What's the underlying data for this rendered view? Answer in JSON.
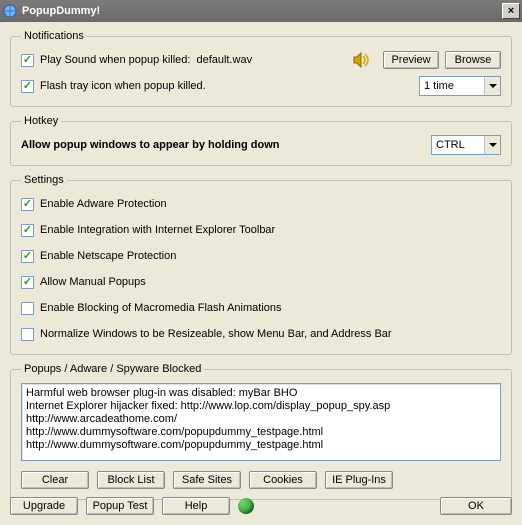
{
  "window": {
    "title": "PopupDummy!",
    "close_glyph": "×"
  },
  "notifications": {
    "legend": "Notifications",
    "play_sound_checked": true,
    "play_sound_label": "Play Sound when popup killed:",
    "sound_file": "default.wav",
    "preview_label": "Preview",
    "browse_label": "Browse",
    "flash_tray_checked": true,
    "flash_tray_label": "Flash tray icon when popup killed.",
    "flash_times_value": "1 time"
  },
  "hotkey": {
    "legend": "Hotkey",
    "label": "Allow popup windows to appear by holding down",
    "value": "CTRL"
  },
  "settings": {
    "legend": "Settings",
    "items": [
      {
        "checked": true,
        "label": "Enable Adware Protection"
      },
      {
        "checked": true,
        "label": "Enable Integration with Internet Explorer Toolbar"
      },
      {
        "checked": true,
        "label": "Enable Netscape Protection"
      },
      {
        "checked": true,
        "label": "Allow Manual Popups"
      },
      {
        "checked": false,
        "label": "Enable Blocking of Macromedia Flash Animations"
      },
      {
        "checked": false,
        "label": "Normalize Windows to be Resizeable, show Menu Bar, and Address Bar"
      }
    ]
  },
  "blocked": {
    "legend": "Popups / Adware / Spyware Blocked",
    "log": [
      "Harmful web browser plug-in was disabled: myBar BHO",
      "Internet Explorer hijacker fixed: http://www.lop.com/display_popup_spy.asp",
      "http://www.arcadeathome.com/",
      "http://www.dummysoftware.com/popupdummy_testpage.html",
      "http://www.dummysoftware.com/popupdummy_testpage.html"
    ],
    "buttons": {
      "clear": "Clear",
      "blocklist": "Block List",
      "safesites": "Safe Sites",
      "cookies": "Cookies",
      "ieplugins": "IE Plug-Ins"
    }
  },
  "bottom": {
    "upgrade": "Upgrade",
    "popuptest": "Popup Test",
    "help": "Help",
    "ok": "OK"
  }
}
